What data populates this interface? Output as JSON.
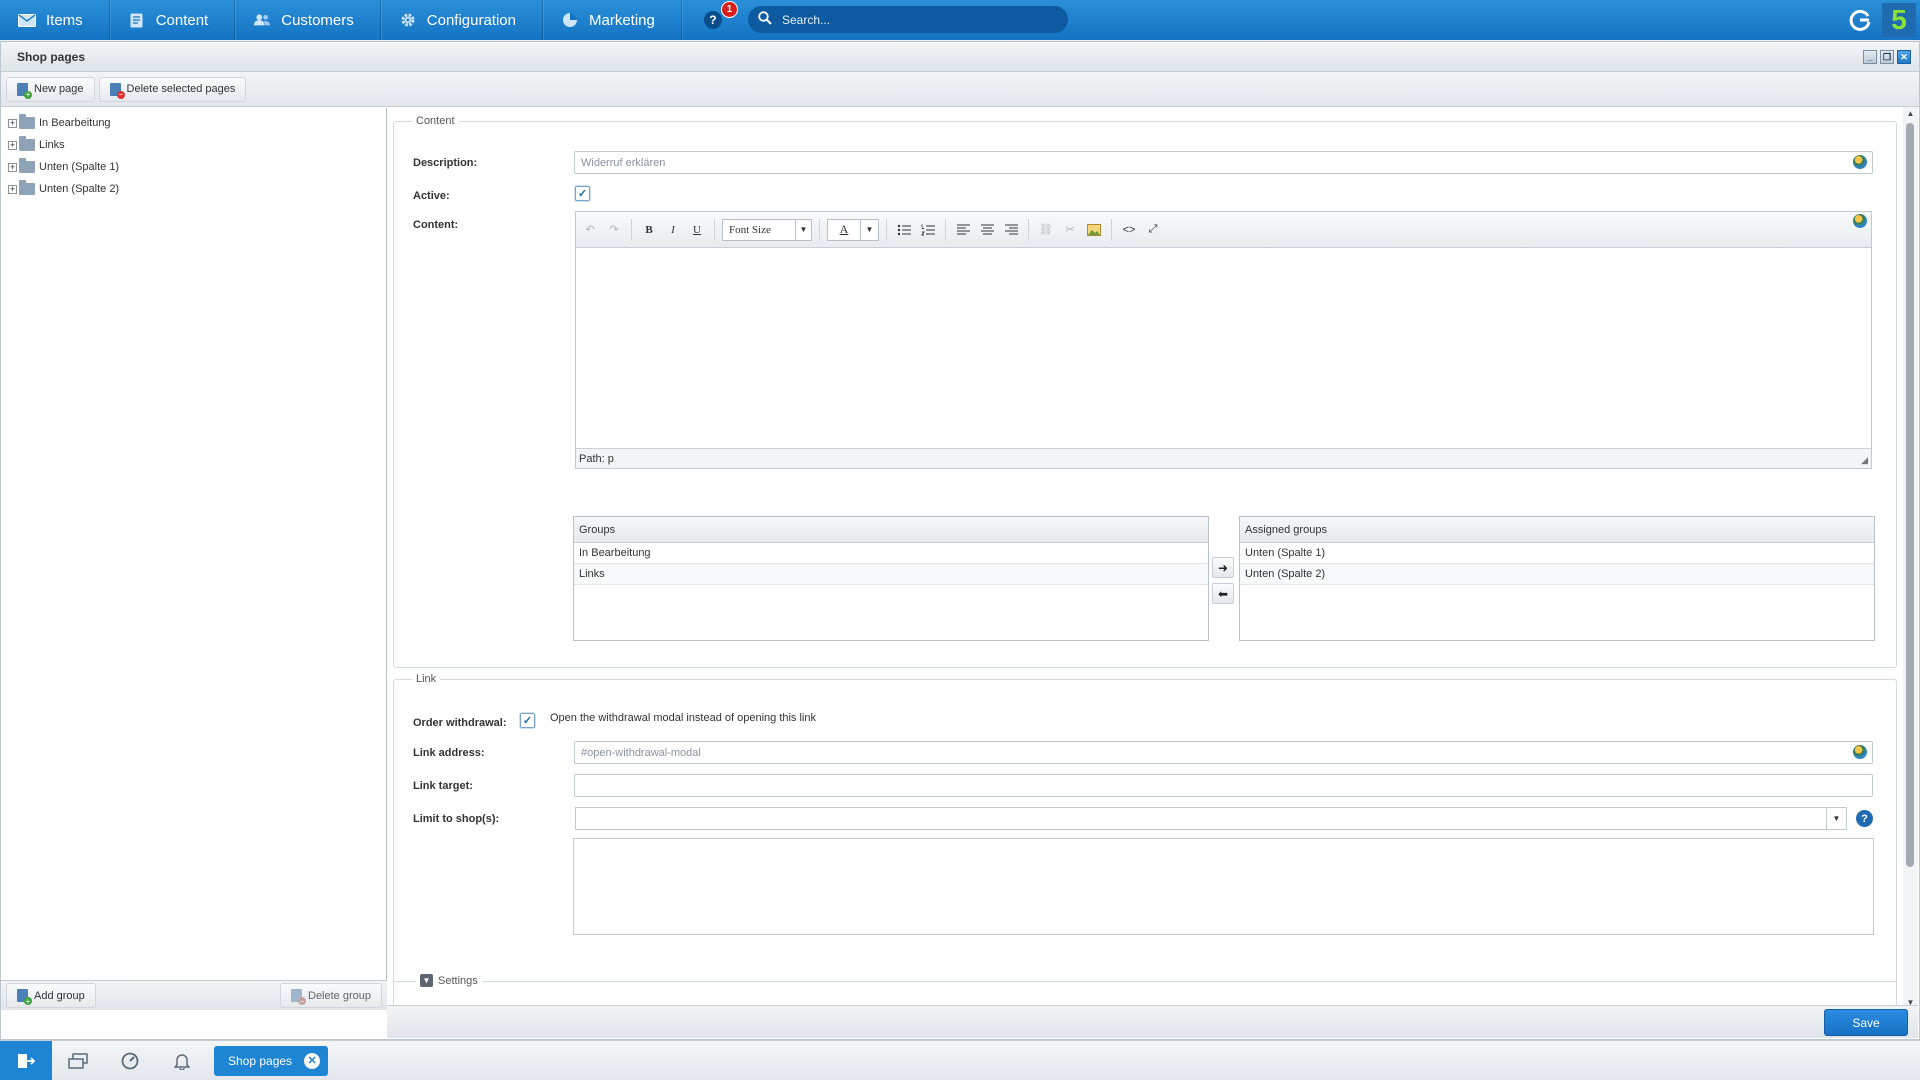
{
  "nav": {
    "items": [
      {
        "label": "Items",
        "icon": "envelope-icon"
      },
      {
        "label": "Content",
        "icon": "document-icon"
      },
      {
        "label": "Customers",
        "icon": "users-icon"
      },
      {
        "label": "Configuration",
        "icon": "gear-icon"
      },
      {
        "label": "Marketing",
        "icon": "pie-chart-icon"
      }
    ],
    "help_label": "?",
    "notification_count": "1",
    "search_placeholder": "Search...",
    "logo_text": "5"
  },
  "window": {
    "title": "Shop pages",
    "toolbar": {
      "new_page": "New page",
      "delete_pages": "Delete selected pages"
    }
  },
  "tree": {
    "items": [
      "In Bearbeitung",
      "Links",
      "Unten (Spalte 1)",
      "Unten (Spalte 2)"
    ],
    "add_group": "Add group",
    "delete_group": "Delete group"
  },
  "content_section": {
    "legend": "Content",
    "description_label": "Description:",
    "description_value": "Widerruf erklären",
    "active_label": "Active:",
    "active_checked": true,
    "content_label": "Content:",
    "editor": {
      "font_size_label": "Font Size",
      "color_label": "A",
      "path_label": "Path: p"
    },
    "groups": {
      "header": "Groups",
      "rows": [
        "In Bearbeitung",
        "Links"
      ]
    },
    "assigned_groups": {
      "header": "Assigned groups",
      "rows": [
        "Unten (Spalte 1)",
        "Unten (Spalte 2)"
      ]
    }
  },
  "link_section": {
    "legend": "Link",
    "order_withdrawal_label": "Order withdrawal:",
    "order_withdrawal_checked": true,
    "order_withdrawal_text": "Open the withdrawal modal instead of opening this link",
    "link_address_label": "Link address:",
    "link_address_value": "#open-withdrawal-modal",
    "link_target_label": "Link target:",
    "link_target_value": "",
    "limit_shop_label": "Limit to shop(s):",
    "limit_shop_value": ""
  },
  "settings_section": {
    "legend": "Settings"
  },
  "save_label": "Save",
  "taskbar": {
    "tab_label": "Shop pages"
  },
  "colors": {
    "accent": "#1e84d4",
    "nav_bg": "#1574c4",
    "logo_green": "#8ce03a"
  }
}
